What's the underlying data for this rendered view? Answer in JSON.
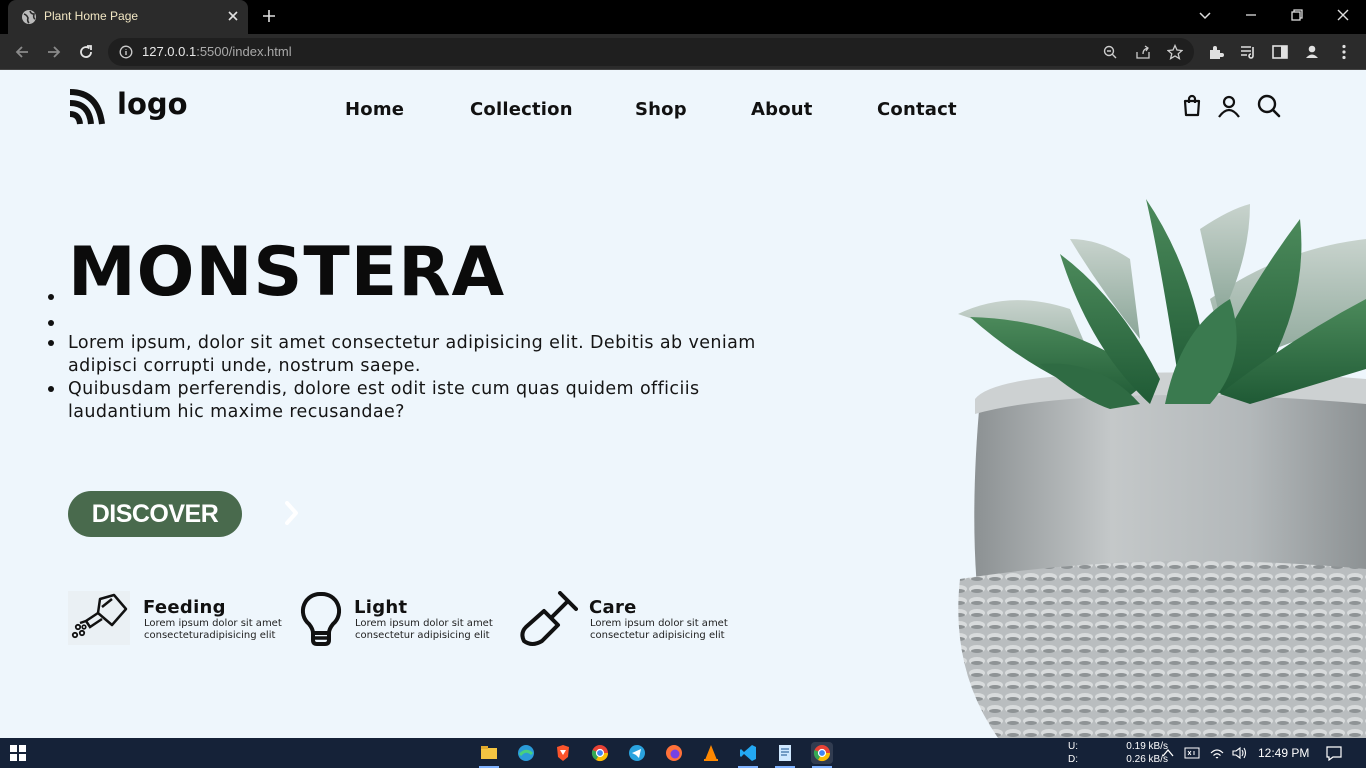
{
  "browser": {
    "tab_title": "Plant Home Page",
    "url_host": "127.0.0.1",
    "url_rest": ":5500/index.html"
  },
  "header": {
    "logo_text": "logo",
    "nav": [
      "Home",
      "Collection",
      "Shop",
      "About",
      "Contact"
    ]
  },
  "hero": {
    "title": "MONSTERA",
    "paragraphs": [
      "Lorem ipsum, dolor sit amet consectetur adipisicing elit. Debitis ab veniam adipisci corrupti unde, nostrum saepe.",
      "Quibusdam perferendis, dolore est odit iste cum quas quidem officiis laudantium hic maxime recusandae?"
    ],
    "cta_label": "DISCOVER"
  },
  "features": [
    {
      "title": "Feeding",
      "desc_line1": "Lorem ipsum dolor sit amet",
      "desc_line2": "consecteturadipisicing elit",
      "icon": "watering-can-icon"
    },
    {
      "title": "Light",
      "desc_line1": "Lorem ipsum dolor sit amet",
      "desc_line2": "consectetur adipisicing elit",
      "icon": "lightbulb-icon"
    },
    {
      "title": "Care",
      "desc_line1": "Lorem ipsum dolor sit amet",
      "desc_line2": "consectetur adipisicing elit",
      "icon": "shovel-icon"
    }
  ],
  "taskbar": {
    "net_up_label": "U:",
    "net_down_label": "D:",
    "net_up": "0.19 kB/s",
    "net_down": "0.26 kB/s",
    "time": "12:49 PM"
  },
  "colors": {
    "page_bg": "#eef6fc",
    "accent_green": "#496a4d",
    "taskbar_bg": "#152238"
  }
}
